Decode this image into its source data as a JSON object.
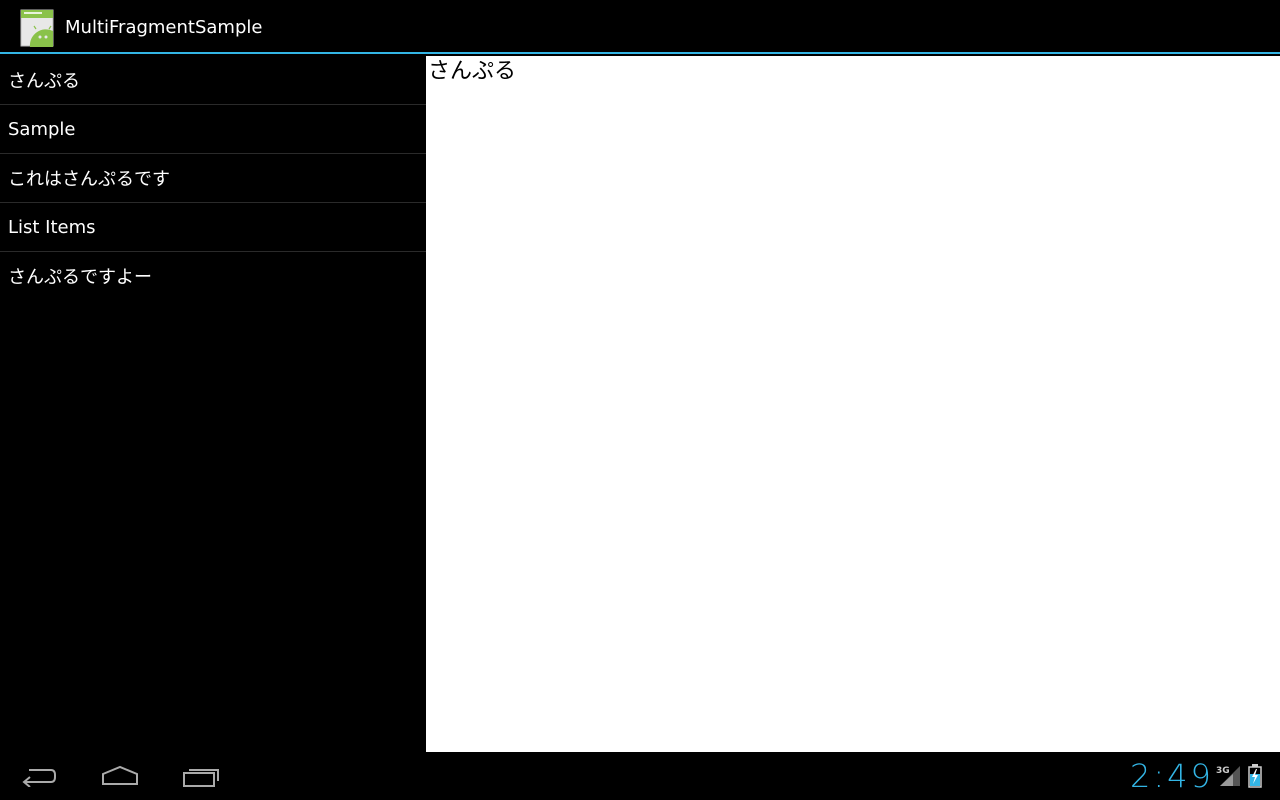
{
  "action_bar": {
    "title": "MultiFragmentSample",
    "icon": "android-app-icon"
  },
  "list": {
    "items": [
      {
        "label": "さんぷる"
      },
      {
        "label": "Sample"
      },
      {
        "label": "これはさんぷるです"
      },
      {
        "label": "List Items"
      },
      {
        "label": "さんぷるですよー"
      }
    ]
  },
  "detail": {
    "text": "さんぷる"
  },
  "system_bar": {
    "clock": "2:49",
    "network_type": "3G",
    "nav_icons": [
      "back-icon",
      "home-icon",
      "recent-apps-icon"
    ],
    "status_icons": [
      "signal-icon",
      "battery-charging-icon"
    ]
  },
  "colors": {
    "accent": "#33b5e5",
    "background": "#000000",
    "detail_background": "#ffffff"
  }
}
